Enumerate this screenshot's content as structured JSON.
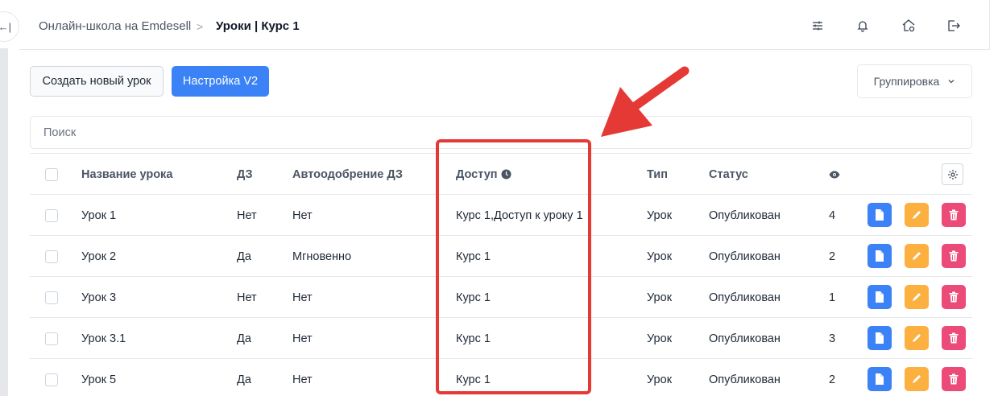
{
  "header": {
    "breadcrumb_root": "Онлайн-школа на Emdesell",
    "breadcrumb_sep": ">",
    "breadcrumb_current": "Уроки | Курс 1",
    "icons": [
      "sliders-icon",
      "bell-icon",
      "home-settings-icon",
      "logout-icon"
    ]
  },
  "sidebar": {
    "collapse_label": "←|"
  },
  "toolbar": {
    "new_lesson_label": "Создать новый урок",
    "settings_label": "Настройка V2",
    "grouping_label": "Группировка",
    "grouping_chevron": "⌄"
  },
  "search": {
    "placeholder": "Поиск"
  },
  "table": {
    "columns": {
      "name": "Название урока",
      "hw": "ДЗ",
      "auto": "Автоодобрение ДЗ",
      "access": "Доступ",
      "type": "Тип",
      "status": "Статус"
    },
    "rows": [
      {
        "name": "Урок 1",
        "hw": "Нет",
        "auto": "Нет",
        "access": "Курс 1,Доступ к уроку 1",
        "type": "Урок",
        "status": "Опубликован",
        "views": "4"
      },
      {
        "name": "Урок 2",
        "hw": "Да",
        "auto": "Мгновенно",
        "access": "Курс 1",
        "type": "Урок",
        "status": "Опубликован",
        "views": "2"
      },
      {
        "name": "Урок 3",
        "hw": "Нет",
        "auto": "Нет",
        "access": "Курс 1",
        "type": "Урок",
        "status": "Опубликован",
        "views": "1"
      },
      {
        "name": "Урок 3.1",
        "hw": "Да",
        "auto": "Нет",
        "access": "Курс 1",
        "type": "Урок",
        "status": "Опубликован",
        "views": "3"
      },
      {
        "name": "Урок 5",
        "hw": "Да",
        "auto": "Нет",
        "access": "Курс 1",
        "type": "Урок",
        "status": "Опубликован",
        "views": "2"
      }
    ]
  },
  "colors": {
    "primary": "#3b82f6",
    "edit": "#fbb040",
    "delete": "#ec4a78",
    "annotation": "#e53935"
  }
}
